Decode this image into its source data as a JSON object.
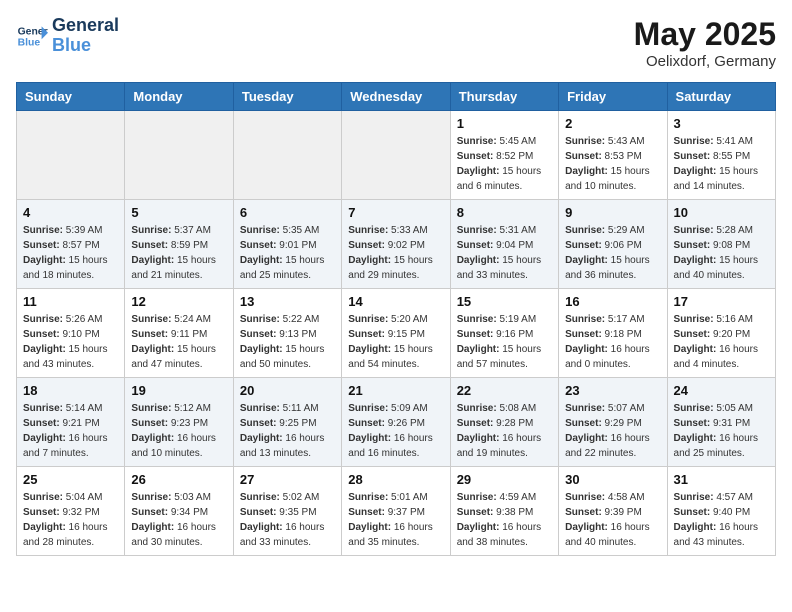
{
  "header": {
    "logo_line1": "General",
    "logo_line2": "Blue",
    "month_year": "May 2025",
    "location": "Oelixdorf, Germany"
  },
  "weekdays": [
    "Sunday",
    "Monday",
    "Tuesday",
    "Wednesday",
    "Thursday",
    "Friday",
    "Saturday"
  ],
  "weeks": [
    [
      {
        "day": "",
        "empty": true
      },
      {
        "day": "",
        "empty": true
      },
      {
        "day": "",
        "empty": true
      },
      {
        "day": "",
        "empty": true
      },
      {
        "day": "1",
        "sunrise": "5:45 AM",
        "sunset": "8:52 PM",
        "daylight": "15 hours and 6 minutes."
      },
      {
        "day": "2",
        "sunrise": "5:43 AM",
        "sunset": "8:53 PM",
        "daylight": "15 hours and 10 minutes."
      },
      {
        "day": "3",
        "sunrise": "5:41 AM",
        "sunset": "8:55 PM",
        "daylight": "15 hours and 14 minutes."
      }
    ],
    [
      {
        "day": "4",
        "sunrise": "5:39 AM",
        "sunset": "8:57 PM",
        "daylight": "15 hours and 18 minutes."
      },
      {
        "day": "5",
        "sunrise": "5:37 AM",
        "sunset": "8:59 PM",
        "daylight": "15 hours and 21 minutes."
      },
      {
        "day": "6",
        "sunrise": "5:35 AM",
        "sunset": "9:01 PM",
        "daylight": "15 hours and 25 minutes."
      },
      {
        "day": "7",
        "sunrise": "5:33 AM",
        "sunset": "9:02 PM",
        "daylight": "15 hours and 29 minutes."
      },
      {
        "day": "8",
        "sunrise": "5:31 AM",
        "sunset": "9:04 PM",
        "daylight": "15 hours and 33 minutes."
      },
      {
        "day": "9",
        "sunrise": "5:29 AM",
        "sunset": "9:06 PM",
        "daylight": "15 hours and 36 minutes."
      },
      {
        "day": "10",
        "sunrise": "5:28 AM",
        "sunset": "9:08 PM",
        "daylight": "15 hours and 40 minutes."
      }
    ],
    [
      {
        "day": "11",
        "sunrise": "5:26 AM",
        "sunset": "9:10 PM",
        "daylight": "15 hours and 43 minutes."
      },
      {
        "day": "12",
        "sunrise": "5:24 AM",
        "sunset": "9:11 PM",
        "daylight": "15 hours and 47 minutes."
      },
      {
        "day": "13",
        "sunrise": "5:22 AM",
        "sunset": "9:13 PM",
        "daylight": "15 hours and 50 minutes."
      },
      {
        "day": "14",
        "sunrise": "5:20 AM",
        "sunset": "9:15 PM",
        "daylight": "15 hours and 54 minutes."
      },
      {
        "day": "15",
        "sunrise": "5:19 AM",
        "sunset": "9:16 PM",
        "daylight": "15 hours and 57 minutes."
      },
      {
        "day": "16",
        "sunrise": "5:17 AM",
        "sunset": "9:18 PM",
        "daylight": "16 hours and 0 minutes."
      },
      {
        "day": "17",
        "sunrise": "5:16 AM",
        "sunset": "9:20 PM",
        "daylight": "16 hours and 4 minutes."
      }
    ],
    [
      {
        "day": "18",
        "sunrise": "5:14 AM",
        "sunset": "9:21 PM",
        "daylight": "16 hours and 7 minutes."
      },
      {
        "day": "19",
        "sunrise": "5:12 AM",
        "sunset": "9:23 PM",
        "daylight": "16 hours and 10 minutes."
      },
      {
        "day": "20",
        "sunrise": "5:11 AM",
        "sunset": "9:25 PM",
        "daylight": "16 hours and 13 minutes."
      },
      {
        "day": "21",
        "sunrise": "5:09 AM",
        "sunset": "9:26 PM",
        "daylight": "16 hours and 16 minutes."
      },
      {
        "day": "22",
        "sunrise": "5:08 AM",
        "sunset": "9:28 PM",
        "daylight": "16 hours and 19 minutes."
      },
      {
        "day": "23",
        "sunrise": "5:07 AM",
        "sunset": "9:29 PM",
        "daylight": "16 hours and 22 minutes."
      },
      {
        "day": "24",
        "sunrise": "5:05 AM",
        "sunset": "9:31 PM",
        "daylight": "16 hours and 25 minutes."
      }
    ],
    [
      {
        "day": "25",
        "sunrise": "5:04 AM",
        "sunset": "9:32 PM",
        "daylight": "16 hours and 28 minutes."
      },
      {
        "day": "26",
        "sunrise": "5:03 AM",
        "sunset": "9:34 PM",
        "daylight": "16 hours and 30 minutes."
      },
      {
        "day": "27",
        "sunrise": "5:02 AM",
        "sunset": "9:35 PM",
        "daylight": "16 hours and 33 minutes."
      },
      {
        "day": "28",
        "sunrise": "5:01 AM",
        "sunset": "9:37 PM",
        "daylight": "16 hours and 35 minutes."
      },
      {
        "day": "29",
        "sunrise": "4:59 AM",
        "sunset": "9:38 PM",
        "daylight": "16 hours and 38 minutes."
      },
      {
        "day": "30",
        "sunrise": "4:58 AM",
        "sunset": "9:39 PM",
        "daylight": "16 hours and 40 minutes."
      },
      {
        "day": "31",
        "sunrise": "4:57 AM",
        "sunset": "9:40 PM",
        "daylight": "16 hours and 43 minutes."
      }
    ]
  ],
  "labels": {
    "sunrise": "Sunrise: ",
    "sunset": "Sunset: ",
    "daylight": "Daylight: "
  }
}
